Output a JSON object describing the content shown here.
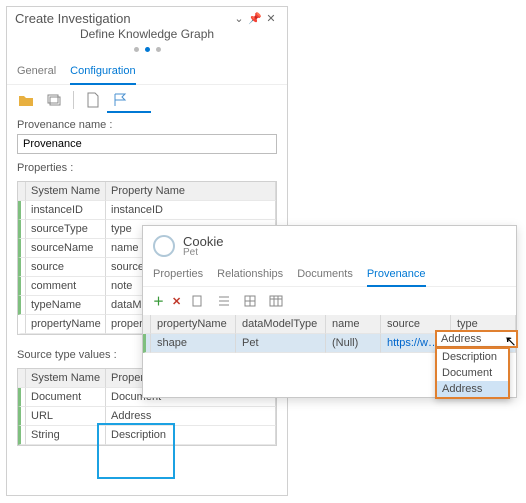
{
  "panel": {
    "title": "Create Investigation",
    "subtitle": "Define Knowledge Graph",
    "tabs": [
      "General",
      "Configuration"
    ],
    "activeTab": 1,
    "provenance": {
      "label": "Provenance name :",
      "value": "Provenance"
    },
    "propsLabel": "Properties :",
    "propCols": [
      "System Name",
      "Property Name"
    ],
    "propRows": [
      [
        "instanceID",
        "instanceID"
      ],
      [
        "sourceType",
        "type"
      ],
      [
        "sourceName",
        "name"
      ],
      [
        "source",
        "source"
      ],
      [
        "comment",
        "note"
      ],
      [
        "typeName",
        "dataModelType"
      ],
      [
        "propertyName",
        "propertyName"
      ]
    ],
    "stvLabel": "Source type values :",
    "stvCols": [
      "System Name",
      "Property Name"
    ],
    "stvRows": [
      [
        "Document",
        "Document"
      ],
      [
        "URL",
        "Address"
      ],
      [
        "String",
        "Description"
      ]
    ]
  },
  "popup": {
    "title": "Cookie",
    "subtitle": "Pet",
    "tabs": [
      "Properties",
      "Relationships",
      "Documents",
      "Provenance"
    ],
    "activeTab": 3,
    "cols": [
      "propertyName",
      "dataModelType",
      "name",
      "source",
      "type"
    ],
    "row": {
      "propertyName": "shape",
      "dataModelType": "Pet",
      "name": "(Null)",
      "source": "https://w…",
      "type": "Address"
    },
    "dropdown": {
      "value": "Address",
      "options": [
        "Description",
        "Document",
        "Address"
      ]
    }
  }
}
